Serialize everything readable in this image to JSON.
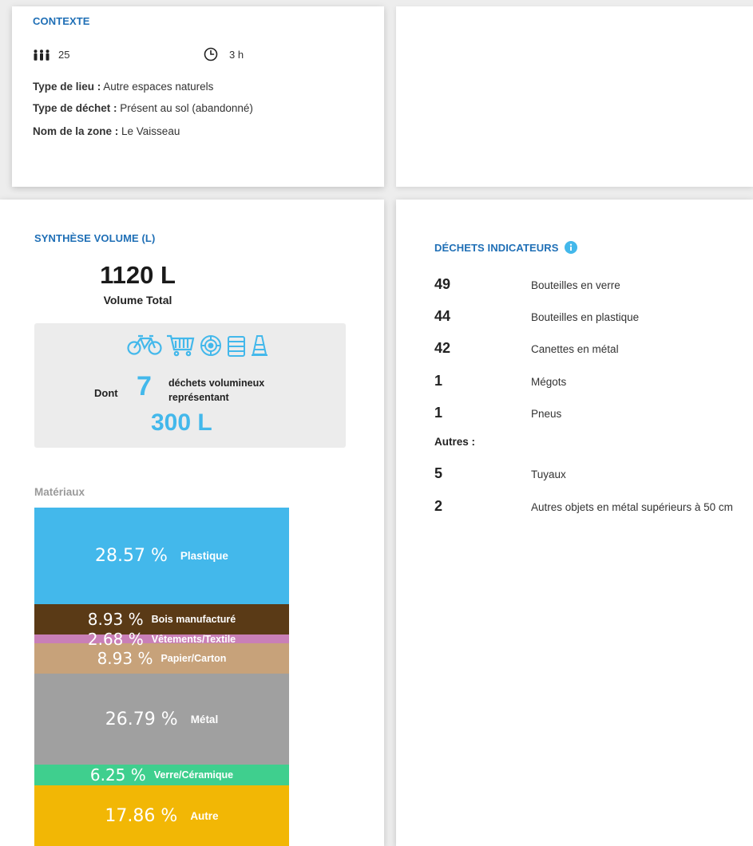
{
  "context": {
    "title": "CONTEXTE",
    "participants": "25",
    "duration": "3 h",
    "lines": [
      {
        "label": "Type de lieu :",
        "value": "Autre espaces naturels"
      },
      {
        "label": "Type de déchet :",
        "value": "Présent au sol (abandonné)"
      },
      {
        "label": "Nom de la zone :",
        "value": "Le Vaisseau"
      }
    ]
  },
  "volume": {
    "title": "SYNTHÈSE VOLUME (L)",
    "total": "1120 L",
    "total_label": "Volume Total",
    "bulky_prefix": "Dont",
    "bulky_count": "7",
    "bulky_text_1": "déchets volumineux",
    "bulky_text_2": "représentant",
    "bulky_volume": "300 L",
    "icons": [
      "bicycle-icon",
      "shopping-cart-icon",
      "tire-icon",
      "cone-icon"
    ]
  },
  "materials": {
    "label": "Matériaux",
    "items": [
      {
        "pct": "28.57 %",
        "name": "Plastique",
        "share": 28.57,
        "color": "#43b8eb"
      },
      {
        "pct": "8.93 %",
        "name": "Bois manufacturé",
        "share": 8.93,
        "color": "#5a3a16"
      },
      {
        "pct": "2.68 %",
        "name": "Vêtements/Textile",
        "share": 2.68,
        "color": "#c97fb7"
      },
      {
        "pct": "8.93 %",
        "name": "Papier/Carton",
        "share": 8.93,
        "color": "#c7a27a"
      },
      {
        "pct": "26.79 %",
        "name": "Métal",
        "share": 26.79,
        "color": "#a0a0a0"
      },
      {
        "pct": "6.25 %",
        "name": "Verre/Céramique",
        "share": 6.25,
        "color": "#3fcf8e"
      },
      {
        "pct": "17.86 %",
        "name": "Autre",
        "share": 17.86,
        "color": "#f2b705"
      }
    ]
  },
  "indicators": {
    "title": "DÉCHETS INDICATEURS",
    "items": [
      {
        "count": "49",
        "label": "Bouteilles en verre"
      },
      {
        "count": "44",
        "label": "Bouteilles en plastique"
      },
      {
        "count": "42",
        "label": "Canettes en métal"
      },
      {
        "count": "1",
        "label": "Mégots"
      },
      {
        "count": "1",
        "label": "Pneus"
      }
    ],
    "others_label": "Autres :",
    "others": [
      {
        "count": "5",
        "label": "Tuyaux"
      },
      {
        "count": "2",
        "label": "Autres objets en métal supérieurs à 50 cm"
      }
    ]
  },
  "colors": {
    "accent": "#1f6fb6",
    "highlight": "#43b8eb",
    "info": "#43b8eb"
  }
}
